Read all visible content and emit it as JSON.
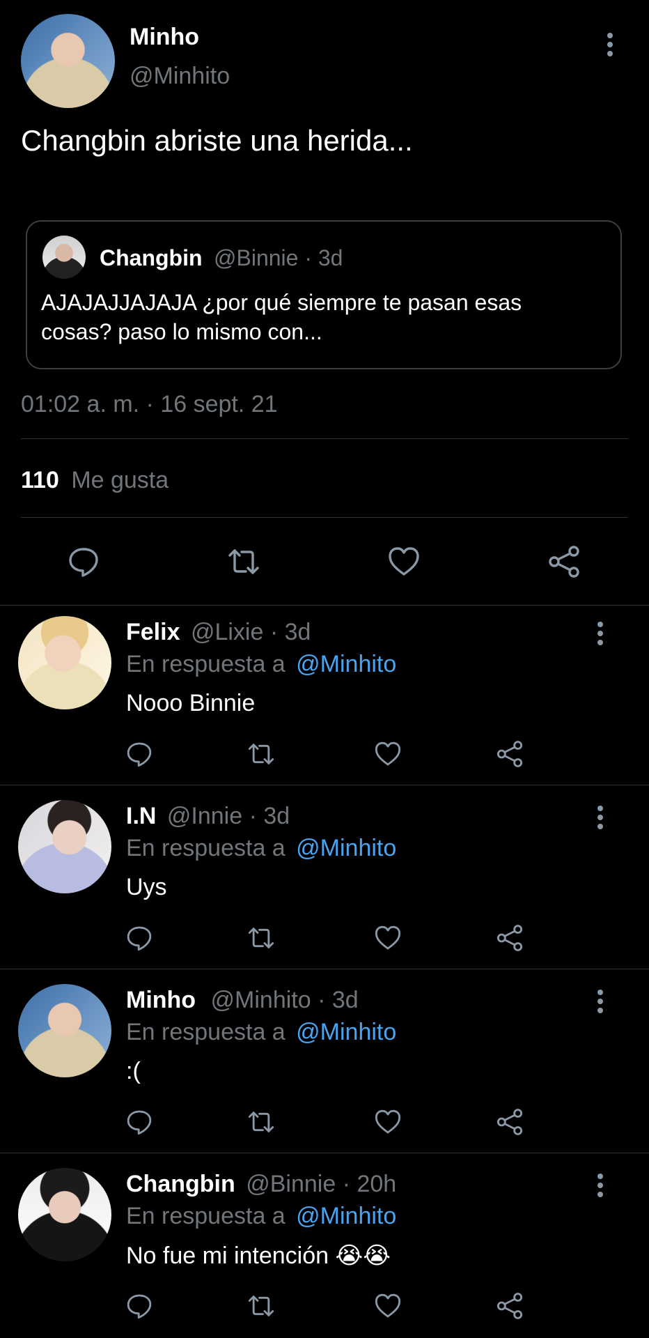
{
  "main_tweet": {
    "author": {
      "name": "Minho",
      "handle": "@Minhito"
    },
    "text": "Changbin abriste una herida...",
    "quoted": {
      "name": "Changbin",
      "meta": "@Binnie · 3d",
      "text_line1": "AJAJAJJAJAJA ¿por qué siempre te pasan esas",
      "text_line2": "cosas? paso lo mismo con..."
    },
    "timestamp": "01:02 a. m. · 16 sept. 21",
    "likes_count": "110",
    "likes_label": "Me gusta"
  },
  "replies": [
    {
      "name": "Felix",
      "meta": "@Lixie · 3d",
      "reply_prefix": "En respuesta a",
      "reply_to": "@Minhito",
      "text": "Nooo Binnie"
    },
    {
      "name": "I.N",
      "meta": "@Innie · 3d",
      "reply_prefix": "En respuesta a",
      "reply_to": "@Minhito",
      "text": "Uys"
    },
    {
      "name": "Minho",
      "meta": "@Minhito · 3d",
      "reply_prefix": "En respuesta a",
      "reply_to": "@Minhito",
      "text": ":("
    },
    {
      "name": "Changbin",
      "meta": "@Binnie · 20h",
      "reply_prefix": "En respuesta a",
      "reply_to": "@Minhito",
      "text": "No fue mi intención 😭😭"
    }
  ],
  "icons": {
    "reply": "speech-bubble-icon",
    "retweet": "retweet-arrows-icon",
    "like": "heart-icon",
    "share": "share-nodes-icon",
    "more": "vertical-ellipsis-icon"
  },
  "colors": {
    "background": "#000000",
    "text": "#e7e9ea",
    "muted": "#71767b",
    "link": "#4aa3ee",
    "divider": "#2f3336"
  }
}
